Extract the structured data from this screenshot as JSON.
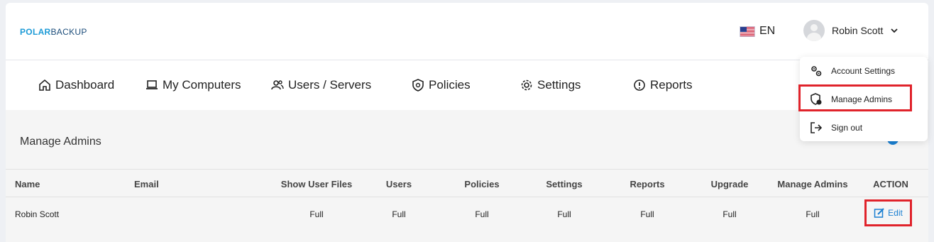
{
  "brand": {
    "logo_bold": "POLAR",
    "logo_rest": "BACKUP"
  },
  "header": {
    "language": "EN",
    "user_name": "Robin Scott"
  },
  "nav": {
    "dashboard": "Dashboard",
    "my_computers": "My Computers",
    "users_servers": "Users / Servers",
    "policies": "Policies",
    "settings": "Settings",
    "reports": "Reports"
  },
  "page": {
    "title": "Manage Admins"
  },
  "table": {
    "headers": {
      "name": "Name",
      "email": "Email",
      "show_user_files": "Show User Files",
      "users": "Users",
      "policies": "Policies",
      "settings": "Settings",
      "reports": "Reports",
      "upgrade": "Upgrade",
      "manage_admins": "Manage Admins",
      "action": "ACTION"
    },
    "row": {
      "name": "Robin Scott",
      "email": "",
      "show_user_files": "Full",
      "users": "Full",
      "policies": "Full",
      "settings": "Full",
      "reports": "Full",
      "upgrade": "Full",
      "manage_admins": "Full",
      "action": "Edit"
    }
  },
  "dropdown": {
    "account_settings": "Account Settings",
    "manage_admins": "Manage Admins",
    "sign_out": "Sign out"
  },
  "colors": {
    "accent": "#1a7fd1",
    "highlight": "#e0232b"
  }
}
